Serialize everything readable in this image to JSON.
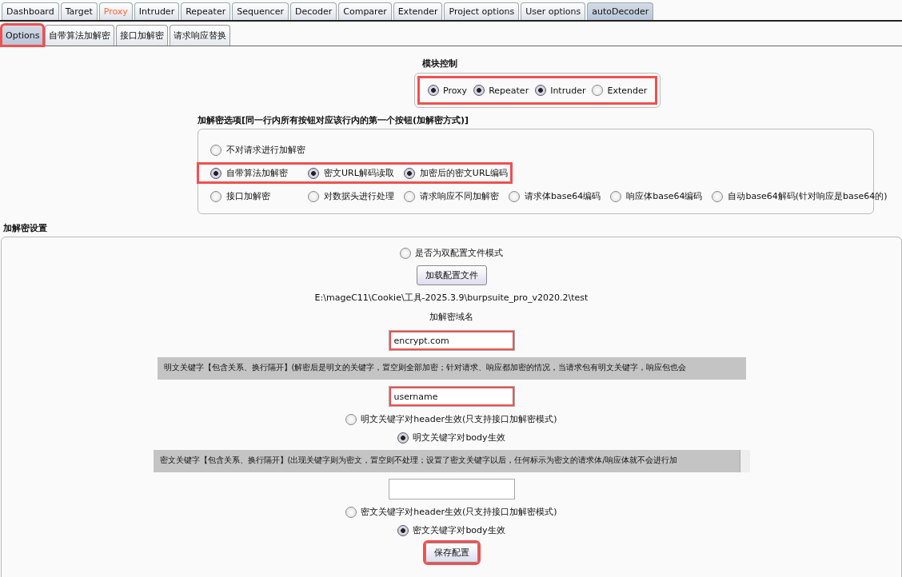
{
  "tabs": [
    {
      "label": "Dashboard",
      "selected": false,
      "alert": false
    },
    {
      "label": "Target",
      "selected": false,
      "alert": false
    },
    {
      "label": "Proxy",
      "selected": false,
      "alert": true
    },
    {
      "label": "Intruder",
      "selected": false,
      "alert": false
    },
    {
      "label": "Repeater",
      "selected": false,
      "alert": false
    },
    {
      "label": "Sequencer",
      "selected": false,
      "alert": false
    },
    {
      "label": "Decoder",
      "selected": false,
      "alert": false
    },
    {
      "label": "Comparer",
      "selected": false,
      "alert": false
    },
    {
      "label": "Extender",
      "selected": false,
      "alert": false
    },
    {
      "label": "Project options",
      "selected": false,
      "alert": false
    },
    {
      "label": "User options",
      "selected": false,
      "alert": false
    },
    {
      "label": "autoDecoder",
      "selected": true,
      "alert": false
    }
  ],
  "subtabs": [
    {
      "label": "Options",
      "selected": true,
      "highlighted": true
    },
    {
      "label": "自带算法加解密",
      "selected": false,
      "highlighted": false
    },
    {
      "label": "接口加解密",
      "selected": false,
      "highlighted": false
    },
    {
      "label": "请求响应替换",
      "selected": false,
      "highlighted": false
    }
  ],
  "module_control": {
    "title": "模块控制",
    "highlighted": true,
    "options": [
      {
        "label": "Proxy",
        "checked": true
      },
      {
        "label": "Repeater",
        "checked": true
      },
      {
        "label": "Intruder",
        "checked": true
      },
      {
        "label": "Extender",
        "checked": false
      }
    ]
  },
  "crypto_options": {
    "title": "加解密选项[同一行内所有按钮对应该行内的第一个按钮(加解密方式)]",
    "rows": [
      {
        "highlighted": false,
        "options": [
          {
            "label": "不对请求进行加解密",
            "checked": false
          }
        ]
      },
      {
        "highlighted": true,
        "options": [
          {
            "label": "自带算法加解密",
            "checked": true
          },
          {
            "label": "密文URL解码读取",
            "checked": true
          },
          {
            "label": "加密后的密文URL编码",
            "checked": true
          }
        ]
      },
      {
        "highlighted": false,
        "options": [
          {
            "label": "接口加解密",
            "checked": false
          },
          {
            "label": "对数据头进行处理",
            "checked": false
          },
          {
            "label": "请求响应不同加解密",
            "checked": false
          },
          {
            "label": "请求体base64编码",
            "checked": false
          },
          {
            "label": "响应体base64编码",
            "checked": false
          },
          {
            "label": "自动base64解码(针对响应是base64的)",
            "checked": false
          }
        ]
      }
    ]
  },
  "settings": {
    "title": "加解密设置",
    "dual_config": {
      "label": "是否为双配置文件模式",
      "checked": false
    },
    "load_button": "加载配置文件",
    "config_path": "E:\\mageC11\\Cookie\\工具-2025.3.9\\burpsuite_pro_v2020.2\\test",
    "domain_label": "加解密域名",
    "domain_field": {
      "value": "encrypt.com",
      "highlighted": true
    },
    "plain_keyword_note": "明文关键字【包含关系、换行隔开】(解密后是明文的关键字，置空则全部加密；针对请求、响应都加密的情况，当请求包有明文关键字，响应包也会",
    "plain_keyword_field": {
      "value": "username",
      "highlighted": true
    },
    "plain_scope": [
      {
        "label": "明文关键字对header生效(只支持接口加解密模式)",
        "checked": false
      },
      {
        "label": "明文关键字对body生效",
        "checked": true
      }
    ],
    "cipher_keyword_note": "密文关键字【包含关系、换行隔开】(出现关键字则为密文，置空则不处理；设置了密文关键字以后，任何标示为密文的请求体/响应体就不会进行加",
    "cipher_keyword_field": {
      "highlighted": false
    },
    "cipher_scope": [
      {
        "label": "密文关键字对header生效(只支持接口加解密模式)",
        "checked": false
      },
      {
        "label": "密文关键字对body生效",
        "checked": true
      }
    ],
    "save_button": {
      "label": "保存配置",
      "highlighted": true
    }
  }
}
